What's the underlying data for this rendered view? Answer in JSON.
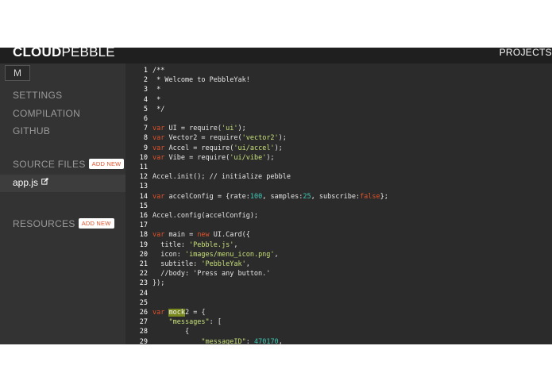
{
  "app": {
    "logo_bold": "CLOUD",
    "logo_rest": "PEBBLE",
    "projects_label": "PROJECTS"
  },
  "sidebar": {
    "menu_button": "M",
    "nav": [
      "SETTINGS",
      "COMPILATION",
      "GITHUB"
    ],
    "source_files_title": "SOURCE FILES",
    "source_add_label": "ADD NEW",
    "files": [
      "app.js"
    ],
    "resources_title": "RESOURCES",
    "resources_add_label": "ADD NEW"
  },
  "editor": {
    "lines": [
      {
        "n": "1",
        "segs": [
          [
            "c",
            "/**"
          ]
        ]
      },
      {
        "n": "2",
        "segs": [
          [
            "c",
            " * Welcome to PebbleYak!"
          ]
        ]
      },
      {
        "n": "3",
        "segs": [
          [
            "c",
            " *"
          ]
        ]
      },
      {
        "n": "4",
        "segs": [
          [
            "c",
            " *"
          ]
        ]
      },
      {
        "n": "5",
        "segs": [
          [
            "c",
            " */"
          ]
        ]
      },
      {
        "n": "6",
        "segs": []
      },
      {
        "n": "7",
        "segs": [
          [
            "kw",
            "var "
          ],
          [
            "id",
            "UI = require("
          ],
          [
            "str",
            "'ui'"
          ],
          [
            "id",
            ");"
          ]
        ]
      },
      {
        "n": "8",
        "segs": [
          [
            "kw",
            "var "
          ],
          [
            "id",
            "Vector2 = require("
          ],
          [
            "str",
            "'vector2'"
          ],
          [
            "id",
            ");"
          ]
        ]
      },
      {
        "n": "9",
        "segs": [
          [
            "kw",
            "var "
          ],
          [
            "id",
            "Accel = require("
          ],
          [
            "str",
            "'ui/accel'"
          ],
          [
            "id",
            ");"
          ]
        ]
      },
      {
        "n": "10",
        "segs": [
          [
            "kw",
            "var "
          ],
          [
            "id",
            "Vibe = require("
          ],
          [
            "str",
            "'ui/vibe'"
          ],
          [
            "id",
            ");"
          ]
        ]
      },
      {
        "n": "11",
        "segs": []
      },
      {
        "n": "12",
        "segs": [
          [
            "id",
            "Accel.init(); // initialize pebble"
          ]
        ]
      },
      {
        "n": "13",
        "segs": []
      },
      {
        "n": "14",
        "segs": [
          [
            "kw",
            "var "
          ],
          [
            "id",
            "accelConfig = {rate:"
          ],
          [
            "num",
            "100"
          ],
          [
            "id",
            ", samples:"
          ],
          [
            "num",
            "25"
          ],
          [
            "id",
            ", subscribe:"
          ],
          [
            "kw",
            "false"
          ],
          [
            "id",
            "};"
          ]
        ]
      },
      {
        "n": "15",
        "segs": []
      },
      {
        "n": "16",
        "segs": [
          [
            "id",
            "Accel.config(accelConfig);"
          ]
        ]
      },
      {
        "n": "17",
        "segs": []
      },
      {
        "n": "18",
        "segs": [
          [
            "kw",
            "var "
          ],
          [
            "id",
            "main = "
          ],
          [
            "kw",
            "new "
          ],
          [
            "id",
            "UI.Card({"
          ]
        ]
      },
      {
        "n": "19",
        "segs": [
          [
            "id",
            "  title: "
          ],
          [
            "str",
            "'Pebble.js'"
          ],
          [
            "id",
            ","
          ]
        ]
      },
      {
        "n": "20",
        "segs": [
          [
            "id",
            "  icon: "
          ],
          [
            "str",
            "'images/menu_icon.png'"
          ],
          [
            "id",
            ","
          ]
        ]
      },
      {
        "n": "21",
        "segs": [
          [
            "id",
            "  subtitle: "
          ],
          [
            "str",
            "'PebbleYak'"
          ],
          [
            "id",
            ","
          ]
        ]
      },
      {
        "n": "22",
        "segs": [
          [
            "id",
            "  //body: 'Press any button.'"
          ]
        ]
      },
      {
        "n": "23",
        "segs": [
          [
            "id",
            "});"
          ]
        ]
      },
      {
        "n": "24",
        "segs": []
      },
      {
        "n": "25",
        "segs": []
      },
      {
        "n": "26",
        "segs": [
          [
            "kw",
            "var "
          ],
          [
            "hl",
            "mock"
          ],
          [
            "id",
            "2 = {"
          ]
        ]
      },
      {
        "n": "27",
        "segs": [
          [
            "id",
            "    "
          ],
          [
            "str",
            "\"messages\""
          ],
          [
            "id",
            ": ["
          ]
        ]
      },
      {
        "n": "28",
        "segs": [
          [
            "id",
            "        {"
          ]
        ]
      },
      {
        "n": "29",
        "segs": [
          [
            "id",
            "            "
          ],
          [
            "str",
            "\"messageID\""
          ],
          [
            "id",
            ": "
          ],
          [
            "num",
            "470170"
          ],
          [
            "id",
            ","
          ]
        ]
      }
    ]
  }
}
